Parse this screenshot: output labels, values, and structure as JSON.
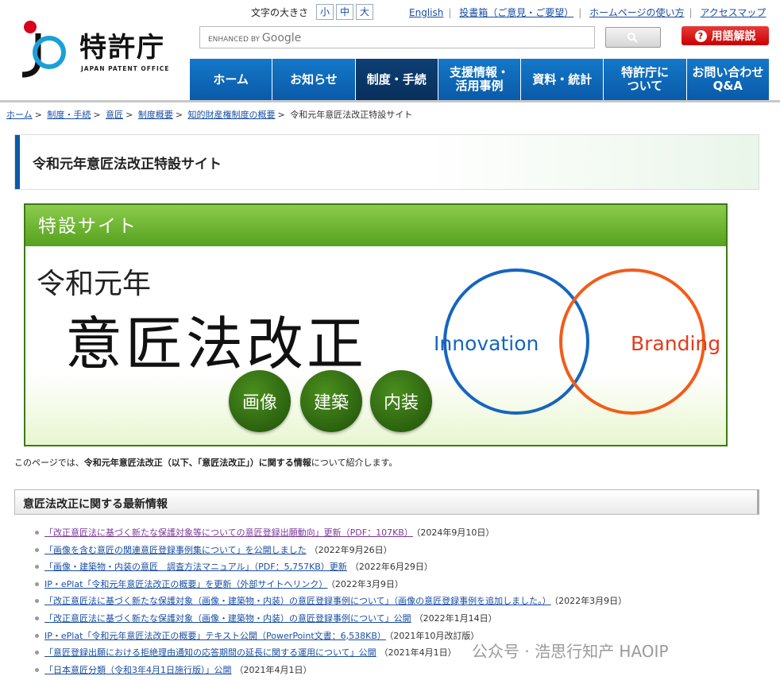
{
  "header": {
    "logo_text": "特許庁",
    "logo_sub": "JAPAN PATENT OFFICE",
    "font_size_label": "文字の大きさ",
    "font_sizes": [
      "小",
      "中",
      "大"
    ],
    "top_links": [
      "English",
      "投書箱（ご意見・ご要望）",
      "ホームページの使い方",
      "アクセスマップ"
    ],
    "search_enhanced": "ENHANCED BY",
    "search_brand": "Google",
    "glossary_label": "用語解説",
    "nav": [
      "ホーム",
      "お知らせ",
      "制度・手続",
      "支援情報・\n活用事例",
      "資料・統計",
      "特許庁に\nついて",
      "お問い合わせ\nQ&A"
    ]
  },
  "breadcrumb": {
    "links": [
      "ホーム",
      "制度・手続",
      "意匠",
      "制度概要",
      "知的財産権制度の概要"
    ],
    "current": "令和元年意匠法改正特設サイト"
  },
  "page_title": "令和元年意匠法改正特設サイト",
  "banner": {
    "head": "特設サイト",
    "sub": "令和元年",
    "main": "意匠法改正",
    "pills": [
      "画像",
      "建築",
      "内装"
    ],
    "circle_a": "Innovation",
    "circle_b": "Branding"
  },
  "intro": {
    "pre": "このページでは、",
    "bold": "令和元年意匠法改正（以下、「意匠法改正」）に関する情報",
    "post": "について紹介します。"
  },
  "section_title": "意匠法改正に関する最新情報",
  "news": [
    {
      "link": "「改正意匠法に基づく新たな保護対象等についての意匠登録出願動向」更新（PDF：107KB）",
      "date": "（2024年9月10日）"
    },
    {
      "link": "「画像を含む意匠の関連意匠登録事例集について」を公開しました",
      "date": "（2022年9月26日）"
    },
    {
      "link": "「画像・建築物・内装の意匠　調査方法マニュアル」（PDF：5,757KB）更新",
      "date": "（2022年6月29日）"
    },
    {
      "link": "IP・ePlat「令和元年意匠法改正の概要」を更新（外部サイトへリンク）",
      "date": "（2022年3月9日）"
    },
    {
      "link": "「改正意匠法に基づく新たな保護対象（画像・建築物・内装）の意匠登録事例について」（画像の意匠登録事例を追加しました。）",
      "date": "（2022年3月9日）"
    },
    {
      "link": "「改正意匠法に基づく新たな保護対象（画像・建築物・内装）の意匠登録事例について」公開",
      "date": "（2022年1月14日）"
    },
    {
      "link": "IP・ePlat「令和元年意匠法改正の概要」テキスト公開（PowerPoint文書：6,538KB）",
      "date": "（2021年10月改訂版）"
    },
    {
      "link": "「意匠登録出願における拒絶理由通知の応答期間の延長に関する運用について」公開",
      "date": "（2021年4月1日）"
    },
    {
      "link": "「日本意匠分類（令和3年4月1日施行版）」公開",
      "date": "（2021年4月1日）"
    }
  ],
  "watermark": "公众号 · 浩思行知产 HAOIP"
}
